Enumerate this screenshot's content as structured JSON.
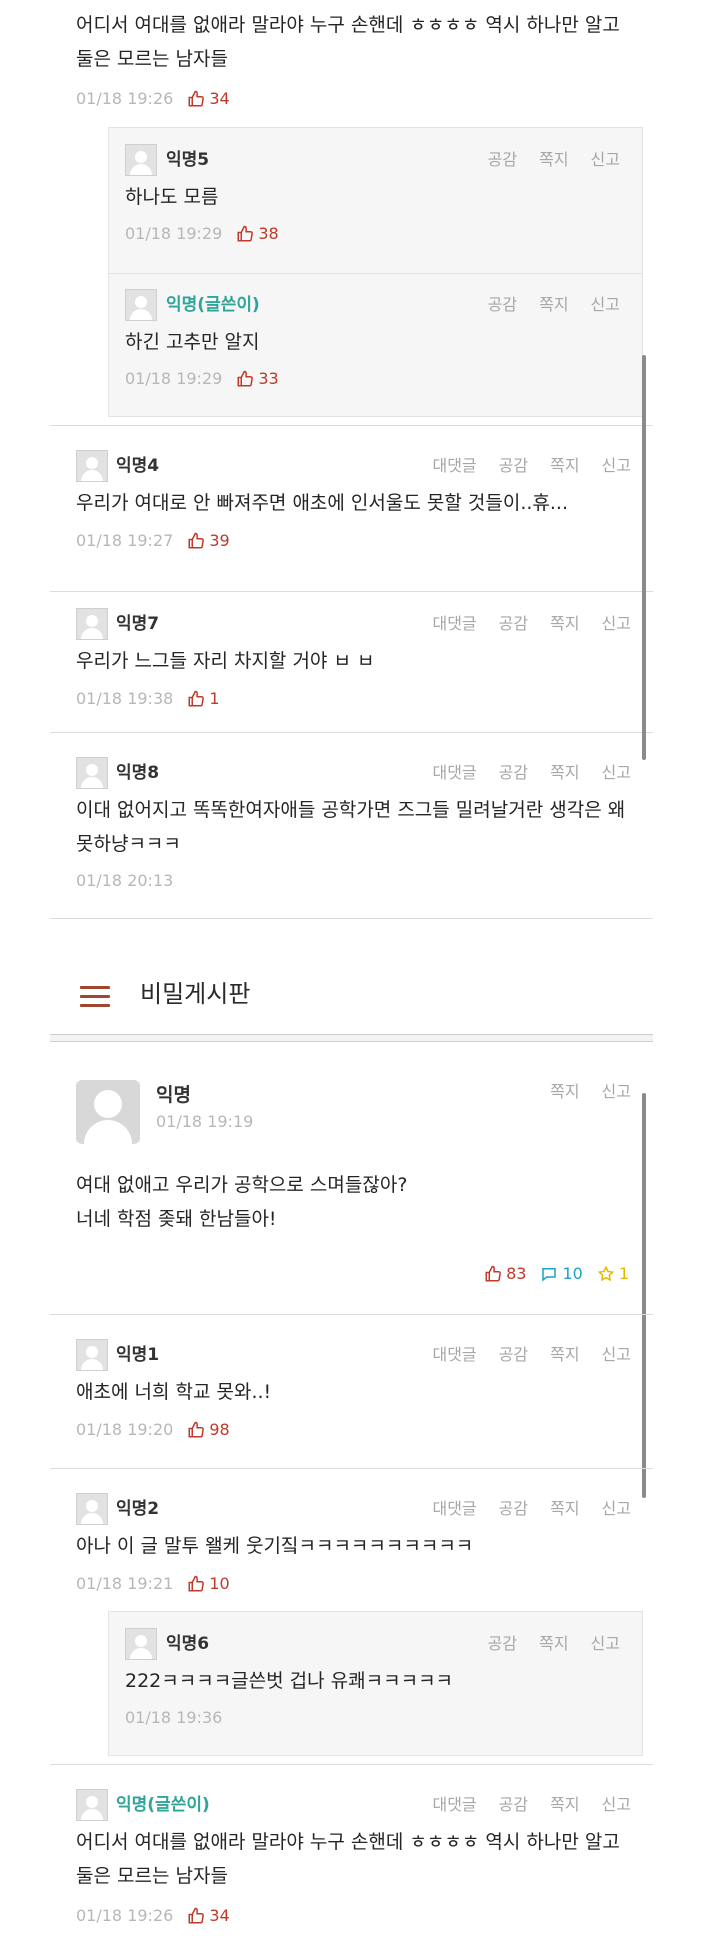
{
  "labels": {
    "reply": "대댓글",
    "empathy": "공감",
    "message": "쪽지",
    "report": "신고"
  },
  "top_section": {
    "comment_tail": {
      "text": "어디서 여대를 없애라 말라야 누구 손핸데 ㅎㅎㅎㅎ 역시 하나만 알고 둘은 모르는 남자들",
      "date": "01/18 19:26",
      "likes": "34"
    },
    "reply_a": {
      "nick": "익명5",
      "text": "하나도 모름",
      "date": "01/18 19:29",
      "likes": "38"
    },
    "reply_b": {
      "nick": "익명(글쓴이)",
      "text": "하긴 고추만 알지",
      "date": "01/18 19:29",
      "likes": "33"
    },
    "c4": {
      "nick": "익명4",
      "text": "우리가 여대로 안 빠져주면 애초에 인서울도 못할 것들이..휴...",
      "date": "01/18 19:27",
      "likes": "39"
    },
    "c7": {
      "nick": "익명7",
      "text": "우리가 느그들 자리 차지할 거야 ㅂ ㅂ",
      "date": "01/18 19:38",
      "likes": "1"
    },
    "c8": {
      "nick": "익명8",
      "text": "이대 없어지고 똑똑한여자애들 공학가면 즈그들 밀려날거란 생각은 왜못하냥ㅋㅋㅋ",
      "date": "01/18 20:13"
    }
  },
  "board": {
    "title": "비밀게시판"
  },
  "post": {
    "nick": "익명",
    "date": "01/18 19:19",
    "line1": "여대 없애고 우리가 공학으로 스며들잖아?",
    "line2": "너네 학점 좆돼 한남들아!",
    "likes": "83",
    "comments": "10",
    "scraps": "1"
  },
  "bottom_section": {
    "c1": {
      "nick": "익명1",
      "text": "애초에 너희 학교 못와..!",
      "date": "01/18 19:20",
      "likes": "98"
    },
    "c2": {
      "nick": "익명2",
      "text": "아나 이 글 말투 왤케 웃기짘ㅋㅋㅋㅋㅋㅋㅋㅋㅋㅋ",
      "date": "01/18 19:21",
      "likes": "10"
    },
    "reply6": {
      "nick": "익명6",
      "text": "222ㅋㅋㅋㅋ글쓴벗 겁나 유쾌ㅋㅋㅋㅋㅋ",
      "date": "01/18 19:36"
    },
    "c_op": {
      "nick": "익명(글쓴이)",
      "text": "어디서 여대를 없애라 말라야 누구 손핸데 ㅎㅎㅎㅎ 역시 하나만 알고 둘은 모르는 남자들",
      "date": "01/18 19:26",
      "likes": "34"
    }
  },
  "colors": {
    "like": "#c0392b",
    "comment": "#1aa3c6",
    "scrap": "#e6b800",
    "op_nick": "#2fa59a",
    "menu": "#a0462f"
  }
}
